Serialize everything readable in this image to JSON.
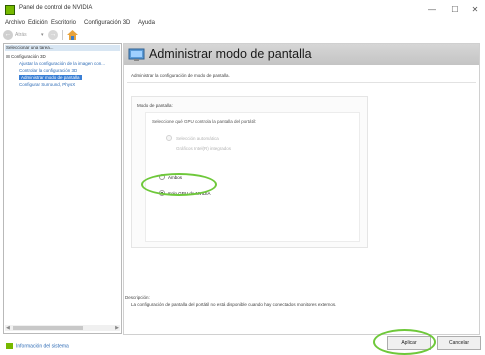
{
  "window": {
    "title": "Panel de control de NVIDIA",
    "controls": {
      "minimize": "—",
      "maximize": "☐",
      "close": "✕"
    },
    "icon": "nvidia-logo-icon"
  },
  "menu": {
    "items": [
      "Archivo",
      "Edición",
      "Escritorio",
      "Configuración 3D",
      "Ayuda"
    ]
  },
  "toolbar": {
    "back_label": "Atrás",
    "back_icon": "back-arrow-icon",
    "forward_icon": "forward-arrow-icon",
    "dropdown_icon": "chevron-down-icon",
    "home_icon": "home-icon"
  },
  "tree": {
    "task_header": "Seleccionar una tarea...",
    "root": "Configuración 3D",
    "items": [
      "Ajustar la configuración de la imagen con...",
      "Controlar la configuración 3D",
      "Administrar modo de pantalla",
      "Configurar Surround, PhysX"
    ],
    "selected_index": 2
  },
  "system_info": "Información del sistema",
  "content": {
    "title": "Administrar modo de pantalla",
    "subtitle": "Administrar la configuración de modo de pantalla.",
    "group_label": "Modo de pantalla:",
    "question": "Seleccione qué GPU controla la pantalla del portátil:",
    "options": [
      {
        "label": "Selección automática",
        "disabled": true
      },
      {
        "label": "Ambos",
        "disabled": false
      },
      {
        "label": "Solo GPU de NVIDIA",
        "disabled": false,
        "checked": true
      }
    ],
    "option_sub": "Gráficos Intel(R) integrados",
    "description_label": "Descripción:",
    "description": "La configuración de pantalla del portátil no está disponible cuando hay conectados monitores externos."
  },
  "buttons": {
    "apply": "Aplicar",
    "cancel": "Cancelar"
  },
  "colors": {
    "highlight": "#6ec83a",
    "link": "#2d6bb5",
    "selection": "#3a7fd5",
    "nvidia_green": "#76b900"
  }
}
